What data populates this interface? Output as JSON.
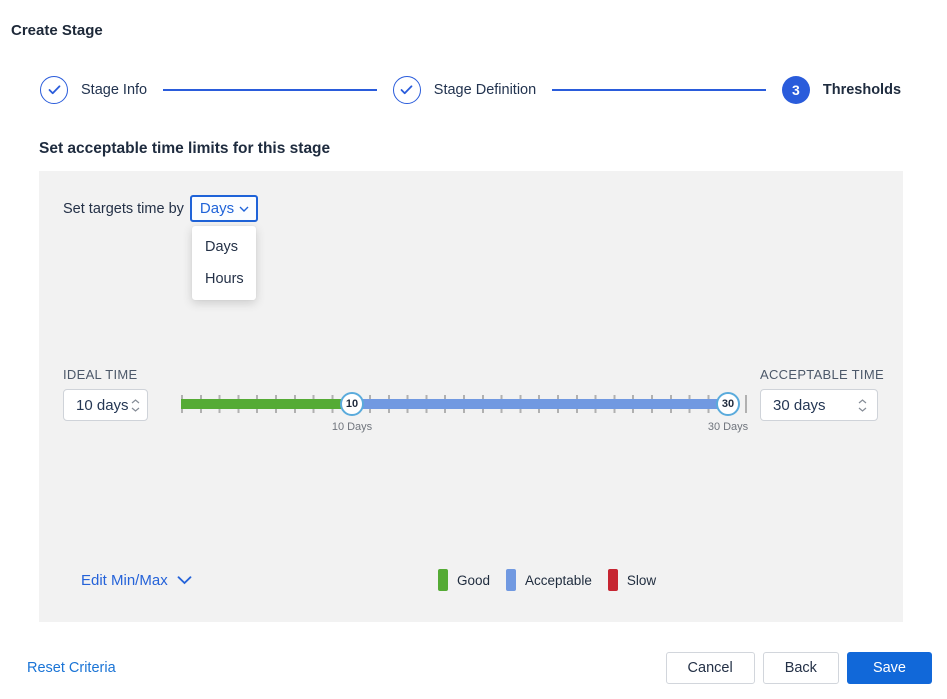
{
  "page_title": "Create Stage",
  "stepper": {
    "steps": [
      {
        "label": "Stage Info",
        "state": "complete"
      },
      {
        "label": "Stage Definition",
        "state": "complete"
      },
      {
        "label": "Thresholds",
        "state": "current",
        "number": "3"
      }
    ]
  },
  "content": {
    "heading": "Set acceptable time limits for this stage",
    "targets_label": "Set targets time by",
    "unit_select": {
      "value": "Days",
      "options": [
        "Days",
        "Hours"
      ]
    },
    "ideal": {
      "label": "IDEAL TIME",
      "value": "10 days"
    },
    "acceptable": {
      "label": "ACCEPTABLE TIME",
      "value": "30 days"
    },
    "slider": {
      "min_value": "10",
      "max_value": "30",
      "min_label": "10 Days",
      "max_label": "30 Days"
    },
    "edit_minmax_label": "Edit Min/Max",
    "legend": [
      {
        "label": "Good",
        "color": "#55ab35"
      },
      {
        "label": "Acceptable",
        "color": "#7199e1"
      },
      {
        "label": "Slow",
        "color": "#c62531"
      }
    ]
  },
  "footer": {
    "reset_label": "Reset Criteria",
    "cancel_label": "Cancel",
    "back_label": "Back",
    "save_label": "Save"
  },
  "colors": {
    "stepper_blue": "#2a5cdb",
    "select_blue": "#1f63d8",
    "link_blue": "#2563d9",
    "primary_button": "#1168d9",
    "good": "#55ab35",
    "acceptable": "#7199e1",
    "slow": "#c62531",
    "handle_border": "#5aabdc",
    "panel_bg": "#f2f2f2"
  }
}
